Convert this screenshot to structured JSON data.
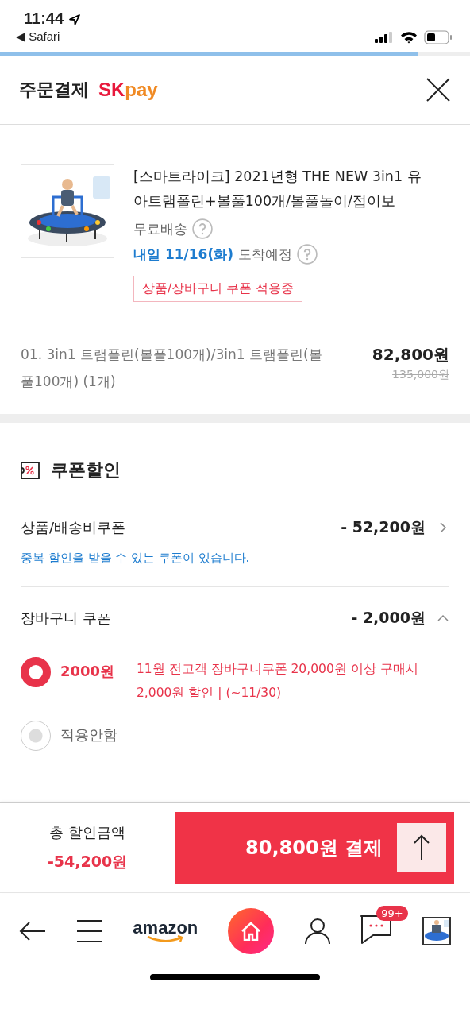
{
  "status_bar": {
    "time": "11:44",
    "back_app": "◀ Safari"
  },
  "load_progress": {
    "level": 0.89
  },
  "header": {
    "title": "주문결제",
    "logo_sk": "SK",
    "logo_pay": "pay"
  },
  "product": {
    "kind": "picture",
    "name": "[스마트라이크] 2021년형 THE NEW 3in1 유아트램폴린+볼풀100개/볼풀놀이/접이보",
    "shipping": "무료배송",
    "delivery_date": "내일 11/16(화)",
    "delivery_note": "도착예정",
    "coupon_tag": "상품/장바구니 쿠폰 적용중",
    "option": "01. 3in1 트램폴린(볼풀100개)/3in1 트램폴린(볼풀100개) (1개)",
    "price": "82,800원",
    "original_price": "135,000원"
  },
  "coupons": {
    "title": "쿠폰할인",
    "rows": [
      {
        "label": "상품/배송비쿠폰",
        "amount": "- 52,200원",
        "expanded": false,
        "note": "중복 할인을 받을 수 있는 쿠폰이 있습니다."
      },
      {
        "label": "장바구니 쿠폰",
        "amount": "- 2,000원",
        "expanded": true,
        "options": [
          {
            "amount": "2000원",
            "description": "11월 전고객 장바구니쿠폰 20,000원 이상 구매시 2,000원 할인 | (~11/30)",
            "selected": true
          },
          {
            "amount": "적용안함",
            "selected": false
          }
        ]
      }
    ]
  },
  "footer": {
    "total_label": "총 할인금액",
    "total": "-54,200원",
    "pay_button": "80,800원 결제"
  },
  "nav": {
    "logo": "amazon",
    "badge": "99+"
  }
}
